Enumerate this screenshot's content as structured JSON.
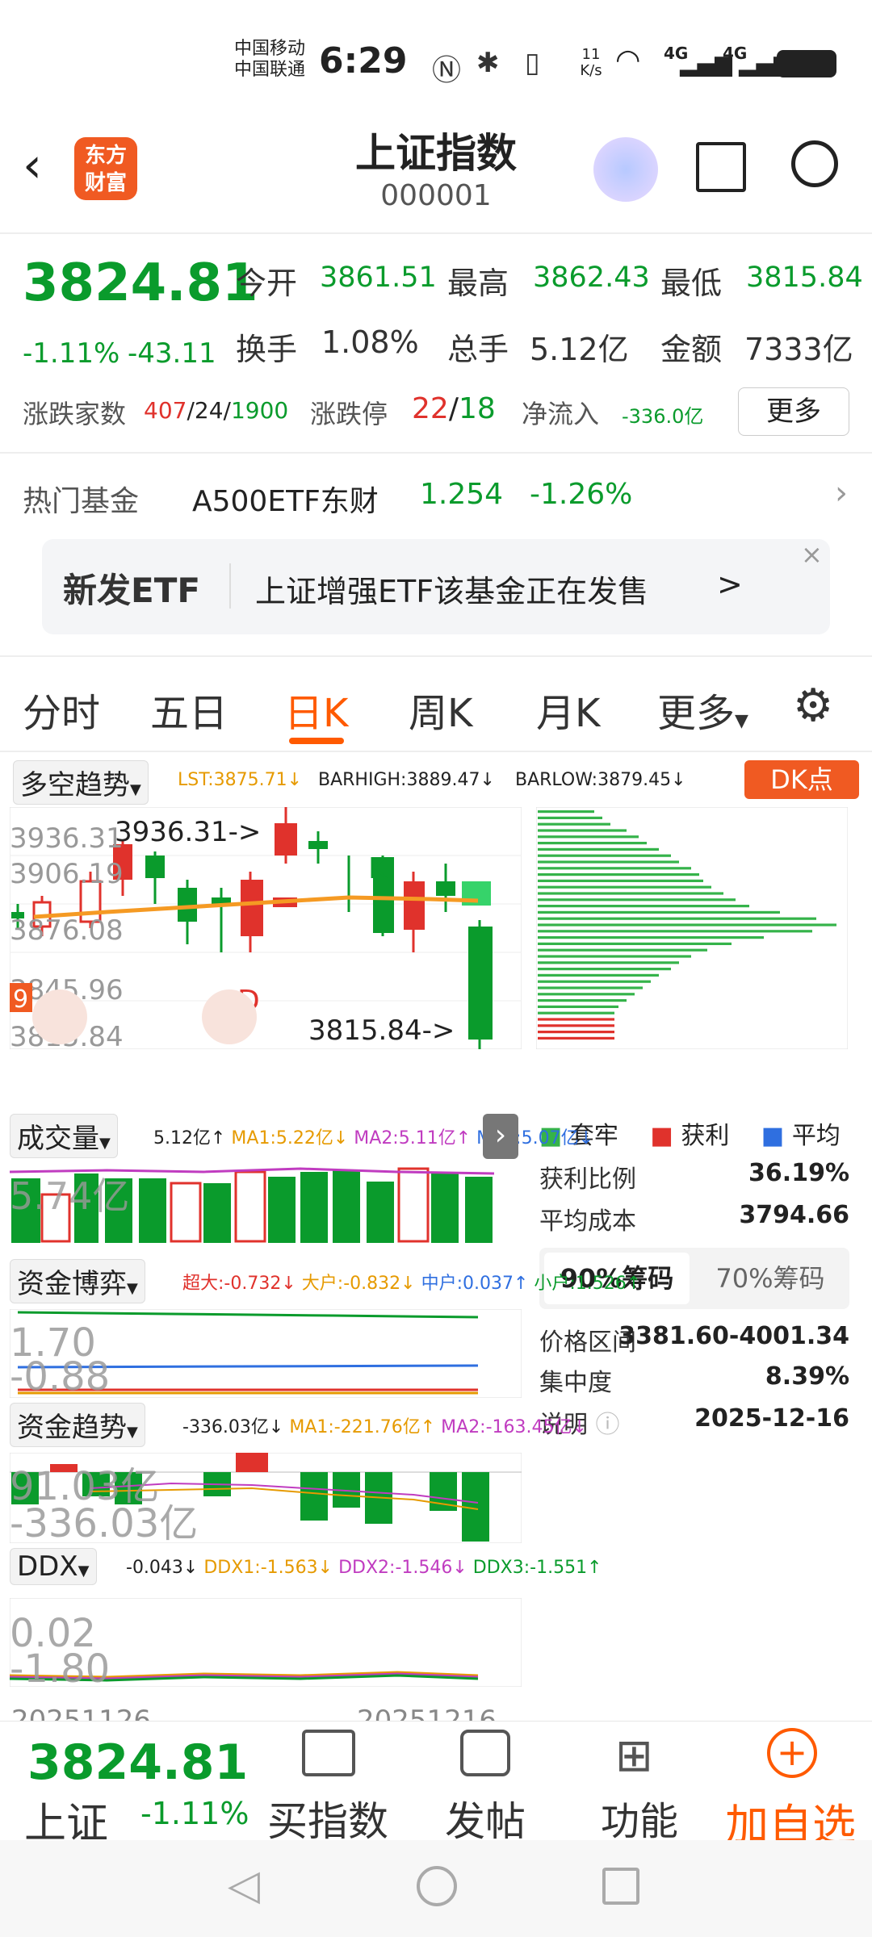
{
  "status": {
    "carrier1": "中国移动",
    "carrier2": "中国联通",
    "time": "6:29",
    "speed": "11 K/s",
    "net1": "4G",
    "net2": "4G"
  },
  "header": {
    "logo_top": "东方",
    "logo_bottom": "财富",
    "title": "上证指数",
    "code": "000001"
  },
  "quote": {
    "price": "3824.81",
    "change_pct": "-1.11%",
    "change": "-43.11",
    "open_label": "今开",
    "open": "3861.51",
    "high_label": "最高",
    "high": "3862.43",
    "low_label": "最低",
    "low": "3815.84",
    "turnover_label": "换手",
    "turnover": "1.08%",
    "volume_label": "总手",
    "volume": "5.12亿",
    "amount_label": "金额",
    "amount": "7333亿",
    "updown_label": "涨跌家数",
    "up": "407",
    "flat": "24",
    "down": "1900",
    "limit_label": "涨跌停",
    "limit_up": "22",
    "limit_down": "18",
    "inflow_label": "净流入",
    "inflow": "-336.0亿",
    "more_button": "更多"
  },
  "fund": {
    "label": "热门基金",
    "name": "A500ETF东财",
    "price": "1.254",
    "pct": "-1.26%"
  },
  "banner": {
    "tag": "新发ETF",
    "text": "上证增强ETF该基金正在发售",
    "arrow": ">",
    "close": "×"
  },
  "tabs": [
    "分时",
    "五日",
    "日K",
    "周K",
    "月K",
    "更多"
  ],
  "chart": {
    "indicator_select": "多空趋势",
    "lst": "LST:3875.71↓",
    "barhigh": "BARHIGH:3889.47↓",
    "barlow": "BARLOW:3879.45↓",
    "dk_button": "DK点",
    "y_labels": [
      "3936.31",
      "3906.19",
      "3876.08",
      "3845.96",
      "3815.84"
    ],
    "high_marker": "3936.31->",
    "low_marker": "3815.84->",
    "k_mark": "K",
    "d_mark": "D",
    "side_mark": "9",
    "vol_select": "成交量",
    "vol_val": "5.12亿↑",
    "vol_ma1": "MA1:5.22亿↓",
    "vol_ma2": "MA2:5.11亿↑",
    "vol_ma3": "MA3:5.07亿↓",
    "vol_axis": "5.74亿",
    "fund_select": "资金博弈",
    "fund_big": "超大:-0.732↓",
    "fund_large": "大户:-0.832↓",
    "fund_mid": "中户:0.037↑",
    "fund_small": "小户:1.526↑",
    "fund_axis_top": "1.70",
    "fund_axis_bot": "-0.88",
    "trend_select": "资金趋势",
    "trend_val": "-336.03亿↓",
    "trend_ma1": "MA1:-221.76亿↑",
    "trend_ma2": "MA2:-163.45亿↓",
    "trend_axis_top": "91.03亿",
    "trend_axis_bot": "-336.03亿",
    "ddx_select": "DDX",
    "ddx_val": "-0.043↓",
    "ddx1": "DDX1:-1.563↓",
    "ddx2": "DDX2:-1.546↓",
    "ddx3": "DDX3:-1.551↑",
    "ddx_axis_top": "0.02",
    "ddx_axis_bot": "-1.80",
    "date_left": "20251126",
    "date_right": "20251216"
  },
  "chips": {
    "legend_trap": "套牢",
    "legend_profit": "获利",
    "legend_avg": "平均",
    "profit_ratio_label": "获利比例",
    "profit_ratio": "36.19%",
    "avg_cost_label": "平均成本",
    "avg_cost": "3794.66",
    "tab90": "90%筹码",
    "tab70": "70%筹码",
    "range_label": "价格区间",
    "range": "3381.60-4001.34",
    "conc_label": "集中度",
    "conc": "8.39%",
    "note_label": "说明",
    "note_date": "2025-12-16"
  },
  "bottom": {
    "price": "3824.81",
    "name": "上证",
    "pct": "-1.11%",
    "buy": "买指数",
    "post": "发帖",
    "func": "功能",
    "add": "加自选"
  },
  "colors": {
    "up": "#e0322c",
    "down": "#0a9b2c",
    "accent": "#ff5a00"
  }
}
